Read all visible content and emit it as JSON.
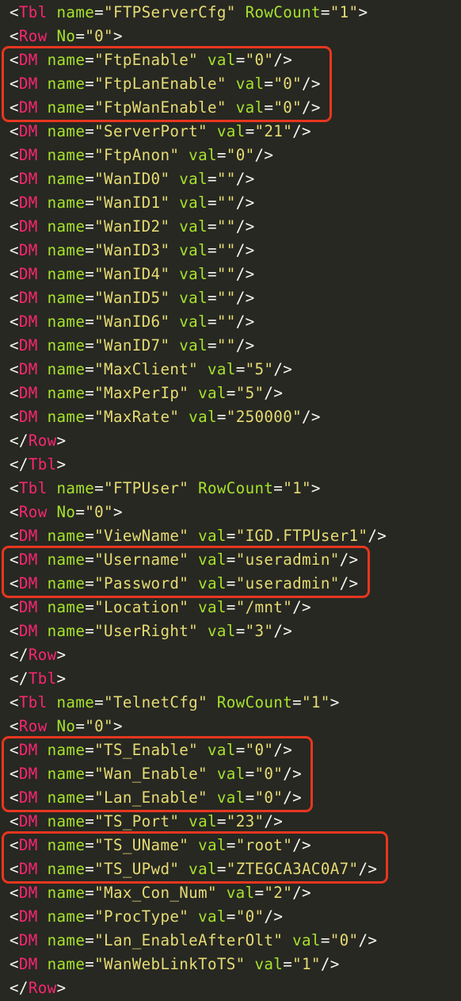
{
  "theme": {
    "background": "#272822",
    "punctuation": "#f8f8f2",
    "tag": "#f92672",
    "attribute": "#a6e22e",
    "string": "#e6db74",
    "highlight": "#e8361f"
  },
  "lines": [
    {
      "tag": "Tbl",
      "attrs": [
        {
          "name": "name",
          "value": "FTPServerCfg"
        },
        {
          "name": "RowCount",
          "value": "1"
        }
      ]
    },
    {
      "tag": "Row",
      "attrs": [
        {
          "name": "No",
          "value": "0"
        }
      ]
    },
    {
      "tag": "DM",
      "attrs": [
        {
          "name": "name",
          "value": "FtpEnable"
        },
        {
          "name": "val",
          "value": "0"
        }
      ],
      "selfClose": true
    },
    {
      "tag": "DM",
      "attrs": [
        {
          "name": "name",
          "value": "FtpLanEnable"
        },
        {
          "name": "val",
          "value": "0"
        }
      ],
      "selfClose": true
    },
    {
      "tag": "DM",
      "attrs": [
        {
          "name": "name",
          "value": "FtpWanEnable"
        },
        {
          "name": "val",
          "value": "0"
        }
      ],
      "selfClose": true
    },
    {
      "tag": "DM",
      "attrs": [
        {
          "name": "name",
          "value": "ServerPort"
        },
        {
          "name": "val",
          "value": "21"
        }
      ],
      "selfClose": true
    },
    {
      "tag": "DM",
      "attrs": [
        {
          "name": "name",
          "value": "FtpAnon"
        },
        {
          "name": "val",
          "value": "0"
        }
      ],
      "selfClose": true
    },
    {
      "tag": "DM",
      "attrs": [
        {
          "name": "name",
          "value": "WanID0"
        },
        {
          "name": "val",
          "value": ""
        }
      ],
      "selfClose": true
    },
    {
      "tag": "DM",
      "attrs": [
        {
          "name": "name",
          "value": "WanID1"
        },
        {
          "name": "val",
          "value": ""
        }
      ],
      "selfClose": true
    },
    {
      "tag": "DM",
      "attrs": [
        {
          "name": "name",
          "value": "WanID2"
        },
        {
          "name": "val",
          "value": ""
        }
      ],
      "selfClose": true
    },
    {
      "tag": "DM",
      "attrs": [
        {
          "name": "name",
          "value": "WanID3"
        },
        {
          "name": "val",
          "value": ""
        }
      ],
      "selfClose": true
    },
    {
      "tag": "DM",
      "attrs": [
        {
          "name": "name",
          "value": "WanID4"
        },
        {
          "name": "val",
          "value": ""
        }
      ],
      "selfClose": true
    },
    {
      "tag": "DM",
      "attrs": [
        {
          "name": "name",
          "value": "WanID5"
        },
        {
          "name": "val",
          "value": ""
        }
      ],
      "selfClose": true
    },
    {
      "tag": "DM",
      "attrs": [
        {
          "name": "name",
          "value": "WanID6"
        },
        {
          "name": "val",
          "value": ""
        }
      ],
      "selfClose": true
    },
    {
      "tag": "DM",
      "attrs": [
        {
          "name": "name",
          "value": "WanID7"
        },
        {
          "name": "val",
          "value": ""
        }
      ],
      "selfClose": true
    },
    {
      "tag": "DM",
      "attrs": [
        {
          "name": "name",
          "value": "MaxClient"
        },
        {
          "name": "val",
          "value": "5"
        }
      ],
      "selfClose": true
    },
    {
      "tag": "DM",
      "attrs": [
        {
          "name": "name",
          "value": "MaxPerIp"
        },
        {
          "name": "val",
          "value": "5"
        }
      ],
      "selfClose": true
    },
    {
      "tag": "DM",
      "attrs": [
        {
          "name": "name",
          "value": "MaxRate"
        },
        {
          "name": "val",
          "value": "250000"
        }
      ],
      "selfClose": true
    },
    {
      "tag": "Row",
      "closing": true
    },
    {
      "tag": "Tbl",
      "closing": true
    },
    {
      "tag": "Tbl",
      "attrs": [
        {
          "name": "name",
          "value": "FTPUser"
        },
        {
          "name": "RowCount",
          "value": "1"
        }
      ]
    },
    {
      "tag": "Row",
      "attrs": [
        {
          "name": "No",
          "value": "0"
        }
      ]
    },
    {
      "tag": "DM",
      "attrs": [
        {
          "name": "name",
          "value": "ViewName"
        },
        {
          "name": "val",
          "value": "IGD.FTPUser1"
        }
      ],
      "selfClose": true
    },
    {
      "tag": "DM",
      "attrs": [
        {
          "name": "name",
          "value": "Username"
        },
        {
          "name": "val",
          "value": "useradmin"
        }
      ],
      "selfClose": true
    },
    {
      "tag": "DM",
      "attrs": [
        {
          "name": "name",
          "value": "Password"
        },
        {
          "name": "val",
          "value": "useradmin"
        }
      ],
      "selfClose": true
    },
    {
      "tag": "DM",
      "attrs": [
        {
          "name": "name",
          "value": "Location"
        },
        {
          "name": "val",
          "value": "/mnt"
        }
      ],
      "selfClose": true
    },
    {
      "tag": "DM",
      "attrs": [
        {
          "name": "name",
          "value": "UserRight"
        },
        {
          "name": "val",
          "value": "3"
        }
      ],
      "selfClose": true
    },
    {
      "tag": "Row",
      "closing": true
    },
    {
      "tag": "Tbl",
      "closing": true
    },
    {
      "tag": "Tbl",
      "attrs": [
        {
          "name": "name",
          "value": "TelnetCfg"
        },
        {
          "name": "RowCount",
          "value": "1"
        }
      ]
    },
    {
      "tag": "Row",
      "attrs": [
        {
          "name": "No",
          "value": "0"
        }
      ]
    },
    {
      "tag": "DM",
      "attrs": [
        {
          "name": "name",
          "value": "TS_Enable"
        },
        {
          "name": "val",
          "value": "0"
        }
      ],
      "selfClose": true
    },
    {
      "tag": "DM",
      "attrs": [
        {
          "name": "name",
          "value": "Wan_Enable"
        },
        {
          "name": "val",
          "value": "0"
        }
      ],
      "selfClose": true
    },
    {
      "tag": "DM",
      "attrs": [
        {
          "name": "name",
          "value": "Lan_Enable"
        },
        {
          "name": "val",
          "value": "0"
        }
      ],
      "selfClose": true
    },
    {
      "tag": "DM",
      "attrs": [
        {
          "name": "name",
          "value": "TS_Port"
        },
        {
          "name": "val",
          "value": "23"
        }
      ],
      "selfClose": true
    },
    {
      "tag": "DM",
      "attrs": [
        {
          "name": "name",
          "value": "TS_UName"
        },
        {
          "name": "val",
          "value": "root"
        }
      ],
      "selfClose": true
    },
    {
      "tag": "DM",
      "attrs": [
        {
          "name": "name",
          "value": "TS_UPwd"
        },
        {
          "name": "val",
          "value": "ZTEGCA3AC0A7"
        }
      ],
      "selfClose": true
    },
    {
      "tag": "DM",
      "attrs": [
        {
          "name": "name",
          "value": "Max_Con_Num"
        },
        {
          "name": "val",
          "value": "2"
        }
      ],
      "selfClose": true
    },
    {
      "tag": "DM",
      "attrs": [
        {
          "name": "name",
          "value": "ProcType"
        },
        {
          "name": "val",
          "value": "0"
        }
      ],
      "selfClose": true
    },
    {
      "tag": "DM",
      "attrs": [
        {
          "name": "name",
          "value": "Lan_EnableAfterOlt"
        },
        {
          "name": "val",
          "value": "0"
        }
      ],
      "selfClose": true
    },
    {
      "tag": "DM",
      "attrs": [
        {
          "name": "name",
          "value": "WanWebLinkToTS"
        },
        {
          "name": "val",
          "value": "1"
        }
      ],
      "selfClose": true
    },
    {
      "tag": "Row",
      "closing": true
    }
  ],
  "highlights": [
    {
      "label": "ftp-enable-flags",
      "first_line": 2,
      "last_line": 4
    },
    {
      "label": "ftp-user-credentials",
      "first_line": 23,
      "last_line": 24
    },
    {
      "label": "telnet-enable-flags",
      "first_line": 31,
      "last_line": 33
    },
    {
      "label": "telnet-credentials",
      "first_line": 35,
      "last_line": 36
    }
  ]
}
